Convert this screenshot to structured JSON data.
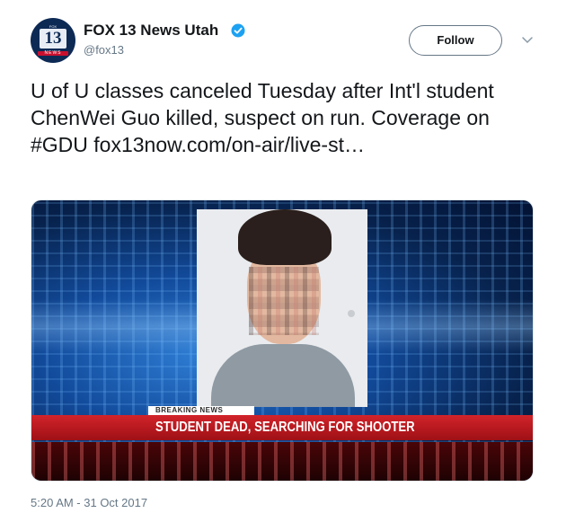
{
  "account": {
    "display_name": "FOX 13 News Utah",
    "handle": "@fox13",
    "avatar_number": "13",
    "avatar_fox": "FOX",
    "avatar_banner": "NEWS"
  },
  "follow_label": "Follow",
  "tweet_text": "U of U classes canceled Tuesday after Int'l student ChenWei Guo killed, suspect on run. Coverage on #GDU fox13now.com/on-air/live-st…",
  "media": {
    "breaking_tag": "BREAKING NEWS",
    "headline": "STUDENT DEAD, SEARCHING FOR SHOOTER"
  },
  "timestamp": "5:20 AM - 31 Oct 2017",
  "colors": {
    "verified": "#1da1f2",
    "banner_red": "#d2232a",
    "secondary_text": "#657786"
  }
}
